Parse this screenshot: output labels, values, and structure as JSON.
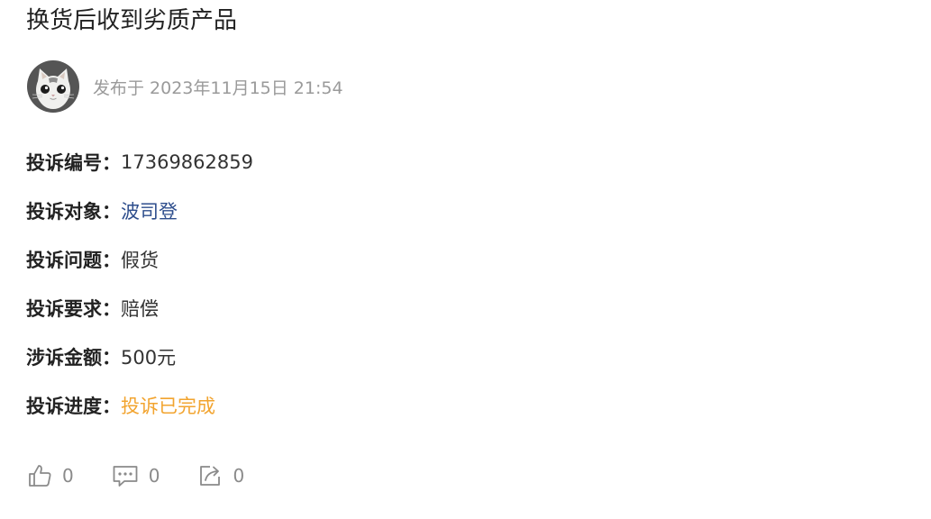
{
  "post": {
    "title": "换货后收到劣质产品",
    "publish_text": "发布于 2023年11月15日 21:54"
  },
  "fields": [
    {
      "label": "投诉编号：",
      "value": "17369862859"
    },
    {
      "label": "投诉对象：",
      "value": "波司登"
    },
    {
      "label": "投诉问题：",
      "value": "假货"
    },
    {
      "label": "投诉要求：",
      "value": "赔偿"
    },
    {
      "label": "涉诉金额：",
      "value": "500元"
    },
    {
      "label": "投诉进度：",
      "value": "投诉已完成"
    }
  ],
  "actions": {
    "like": {
      "icon": "thumbs-up-icon",
      "count": "0"
    },
    "comment": {
      "icon": "comment-icon",
      "count": "0"
    },
    "share": {
      "icon": "share-icon",
      "count": "0"
    }
  },
  "colors": {
    "link": "#2d4d8c",
    "status_done": "#f2a42f",
    "muted": "#9a9a9a"
  }
}
